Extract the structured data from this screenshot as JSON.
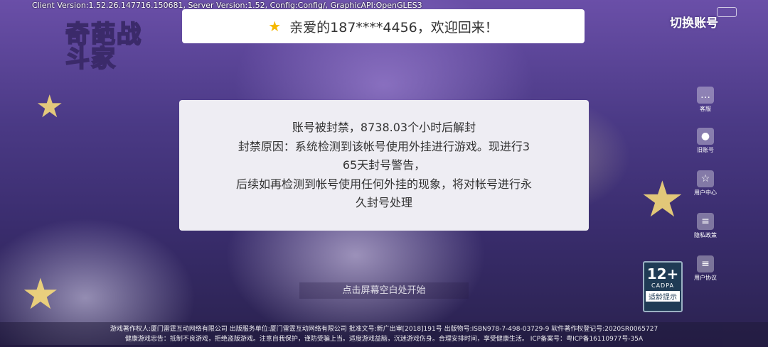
{
  "debug": {
    "version_line": "Client Version:1.52.26.147716.150681, Server Version:1.52, Config:Config/, GraphicAPI:OpenGLES3"
  },
  "logo": {
    "text": "奇葩战斗家"
  },
  "welcome": {
    "icon": "star-icon",
    "text": "亲爱的187****4456，欢迎回来！"
  },
  "header": {
    "switch_account": "切换账号"
  },
  "ban_dialog": {
    "line1": "账号被封禁，8738.03个小时后解封",
    "line2": "封禁原因：系统检测到该帐号使用外挂进行游戏。现进行3",
    "line3": "65天封号警告，",
    "line4": "后续如再检测到帐号使用任何外挂的现象，将对帐号进行永",
    "line5": "久封号处理"
  },
  "side_menu": {
    "items": [
      {
        "label": "客服",
        "icon": "chat-icon"
      },
      {
        "label": "旧账号",
        "icon": "user-icon"
      },
      {
        "label": "用户中心",
        "icon": "user-star-icon"
      },
      {
        "label": "隐私政策",
        "icon": "document-icon"
      },
      {
        "label": "用户协议",
        "icon": "document-icon"
      }
    ]
  },
  "start_hint": "点击屏幕空白处开始",
  "age_rating": {
    "age": "12+",
    "org": "CADPA",
    "tip": "适龄提示"
  },
  "footer": {
    "line1": "游戏著作权人:厦门雷霆互动网络有限公司 出版服务单位:厦门雷霆互动网络有限公司 批准文号:新广出审[2018]191号 出版物号:ISBN978-7-498-03729-9 软件著作权登记号:2020SR0065727",
    "line2": "健康游戏忠告：抵制不良游戏，拒绝盗版游戏。注意自我保护，谨防受骗上当。适度游戏益脑，沉迷游戏伤身。合理安排时间，享受健康生活。    ICP备案号：粤ICP备16110977号-35A"
  }
}
